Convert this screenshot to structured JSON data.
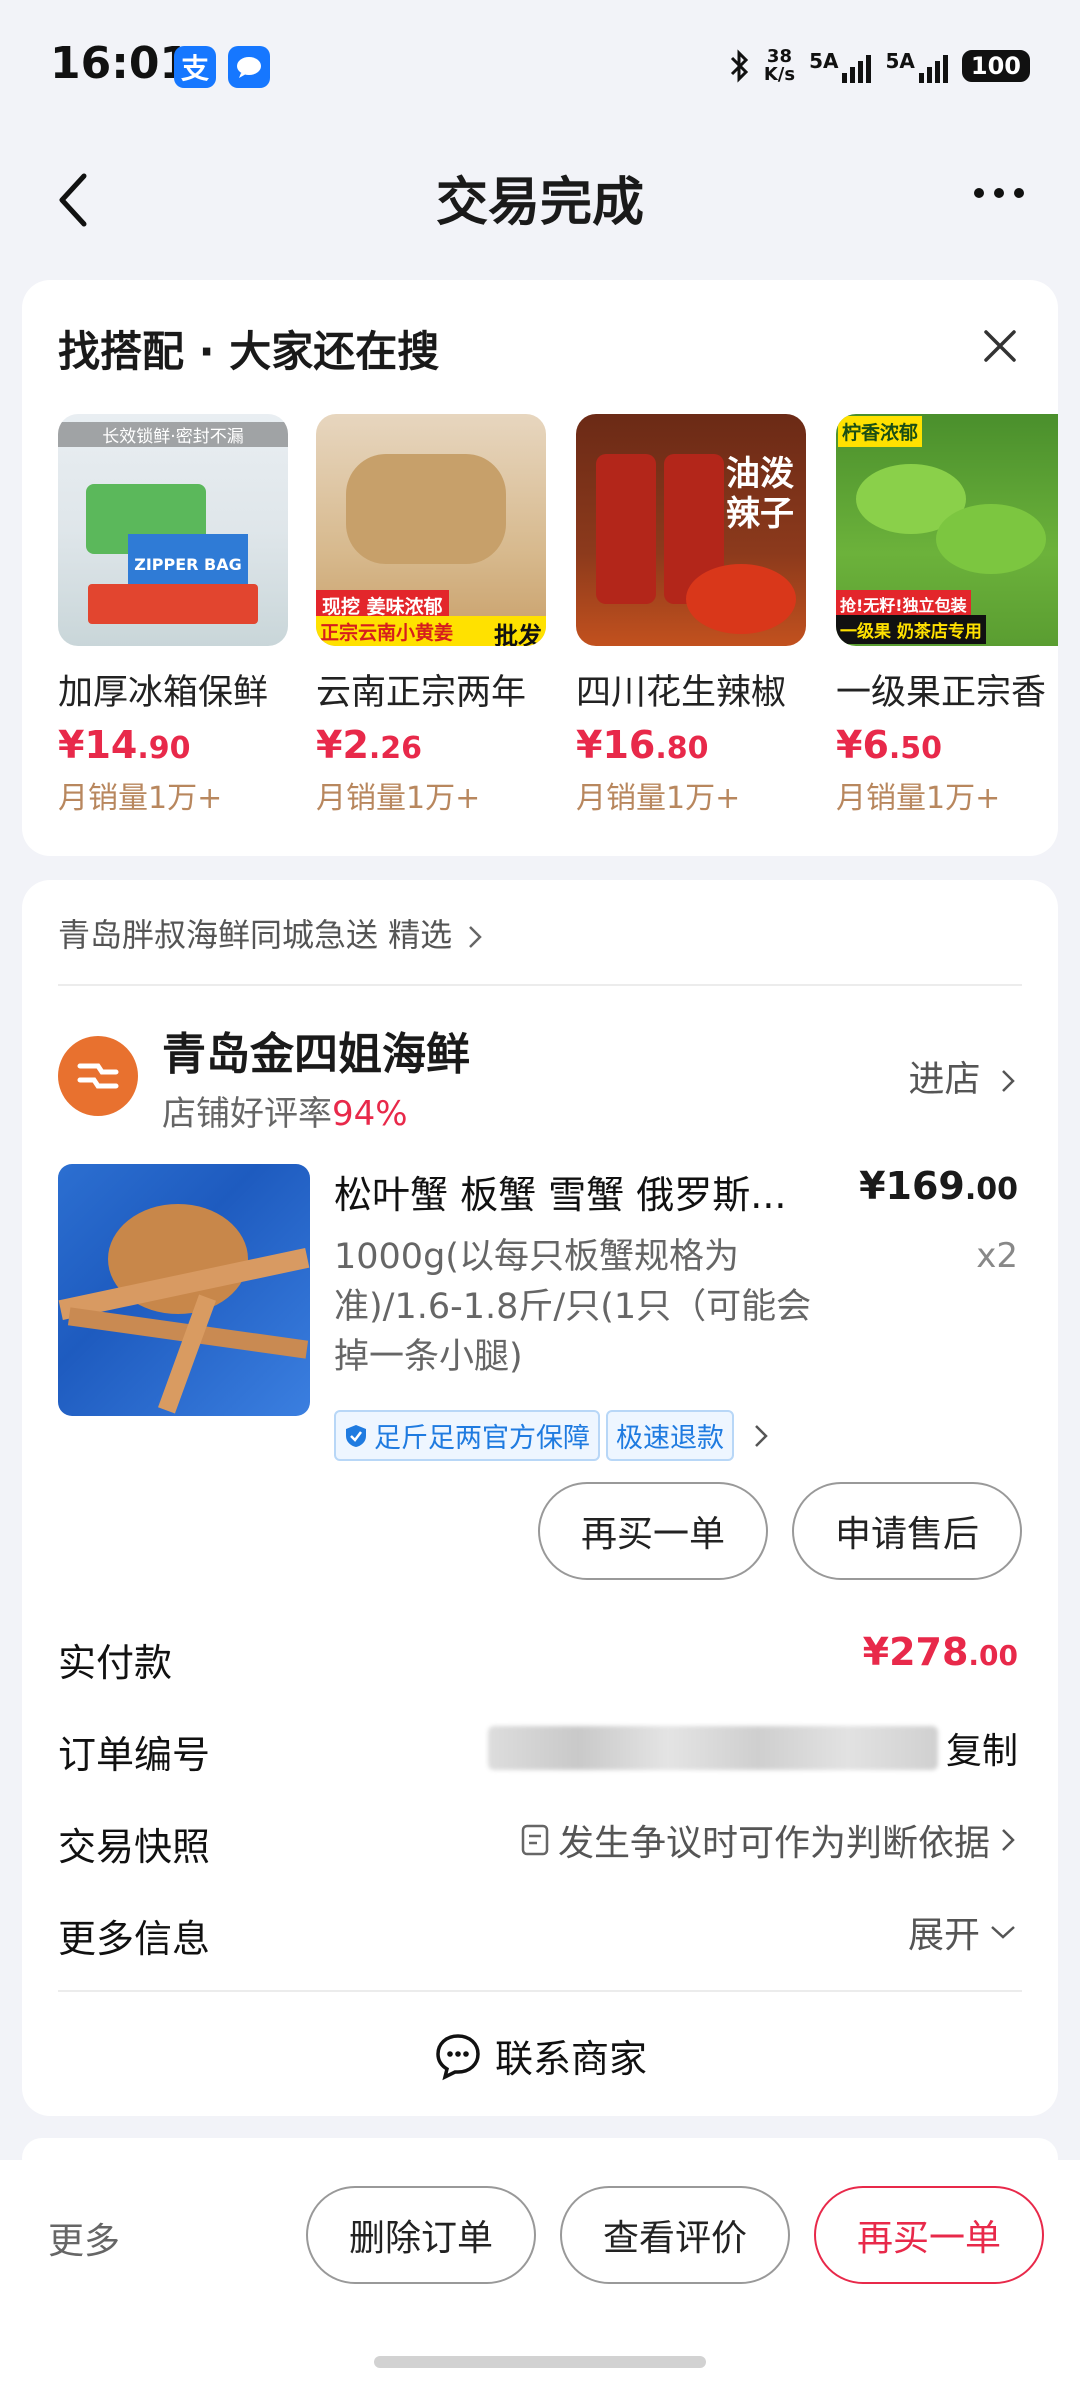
{
  "status_bar": {
    "time": "16:01",
    "app_icon_alipay": "支",
    "net_speed_value": "38",
    "net_speed_unit": "K/s",
    "sim1": "5A",
    "sim2": "5A",
    "battery": "100"
  },
  "nav": {
    "title": "交易完成"
  },
  "recommend": {
    "title": "找搭配 · 大家还在搜",
    "items": [
      {
        "name": "加厚冰箱保鲜",
        "price_int": "¥14",
        "price_dec": ".90",
        "sales": "月销量1万+",
        "banner": "长效锁鲜·密封不漏",
        "tag": "ZIPPER BAG"
      },
      {
        "name": "云南正宗两年",
        "price_int": "¥2",
        "price_dec": ".26",
        "sales": "月销量1万+",
        "banner_top": "现挖 姜味浓郁",
        "banner_bottom": "正宗云南小黄姜",
        "tag": "批发"
      },
      {
        "name": "四川花生辣椒",
        "price_int": "¥16",
        "price_dec": ".80",
        "sales": "月销量1万+",
        "tag": "油泼辣子"
      },
      {
        "name": "一级果正宗香",
        "price_int": "¥6",
        "price_dec": ".50",
        "sales": "月销量1万+",
        "banner": "柠香浓郁",
        "tag1": "抢!无籽!独立包装",
        "tag2": "一级果 奶茶店专用"
      }
    ]
  },
  "order": {
    "seller_tag": "青岛胖叔海鲜同城急送 精选",
    "shop_name": "青岛金四姐海鲜",
    "shop_rate_label": "店铺好评率",
    "shop_rate_value": "94%",
    "enter_shop": "进店",
    "product": {
      "title": "松叶蟹 板蟹 雪蟹  俄罗斯...",
      "spec": "1000g(以每只板蟹规格为准)/1.6-1.8斤/只(1只（可能会掉一条小腿)",
      "price_int": "¥169",
      "price_dec": ".00",
      "qty": "x2",
      "badge1": "足斤足两官方保障",
      "badge2": "极速退款"
    },
    "buy_again": "再买一单",
    "after_sale": "申请售后",
    "paid_label": "实付款",
    "paid_int": "¥278",
    "paid_dec": ".00",
    "order_no_label": "订单编号",
    "copy": "复制",
    "snapshot_label": "交易快照",
    "snapshot_value": "发生争议时可作为判断依据",
    "more_info_label": "更多信息",
    "expand": "展开",
    "contact": "联系商家"
  },
  "bottom_bar": {
    "more": "更多",
    "delete": "删除订单",
    "view_review": "查看评价",
    "buy_again": "再买一单"
  },
  "colors": {
    "price_red": "#e8294a",
    "background": "#f2f3f8",
    "shop_logo": "#e8712f",
    "sales_brown": "#b8875e",
    "badge_blue": "#1f7be0"
  }
}
